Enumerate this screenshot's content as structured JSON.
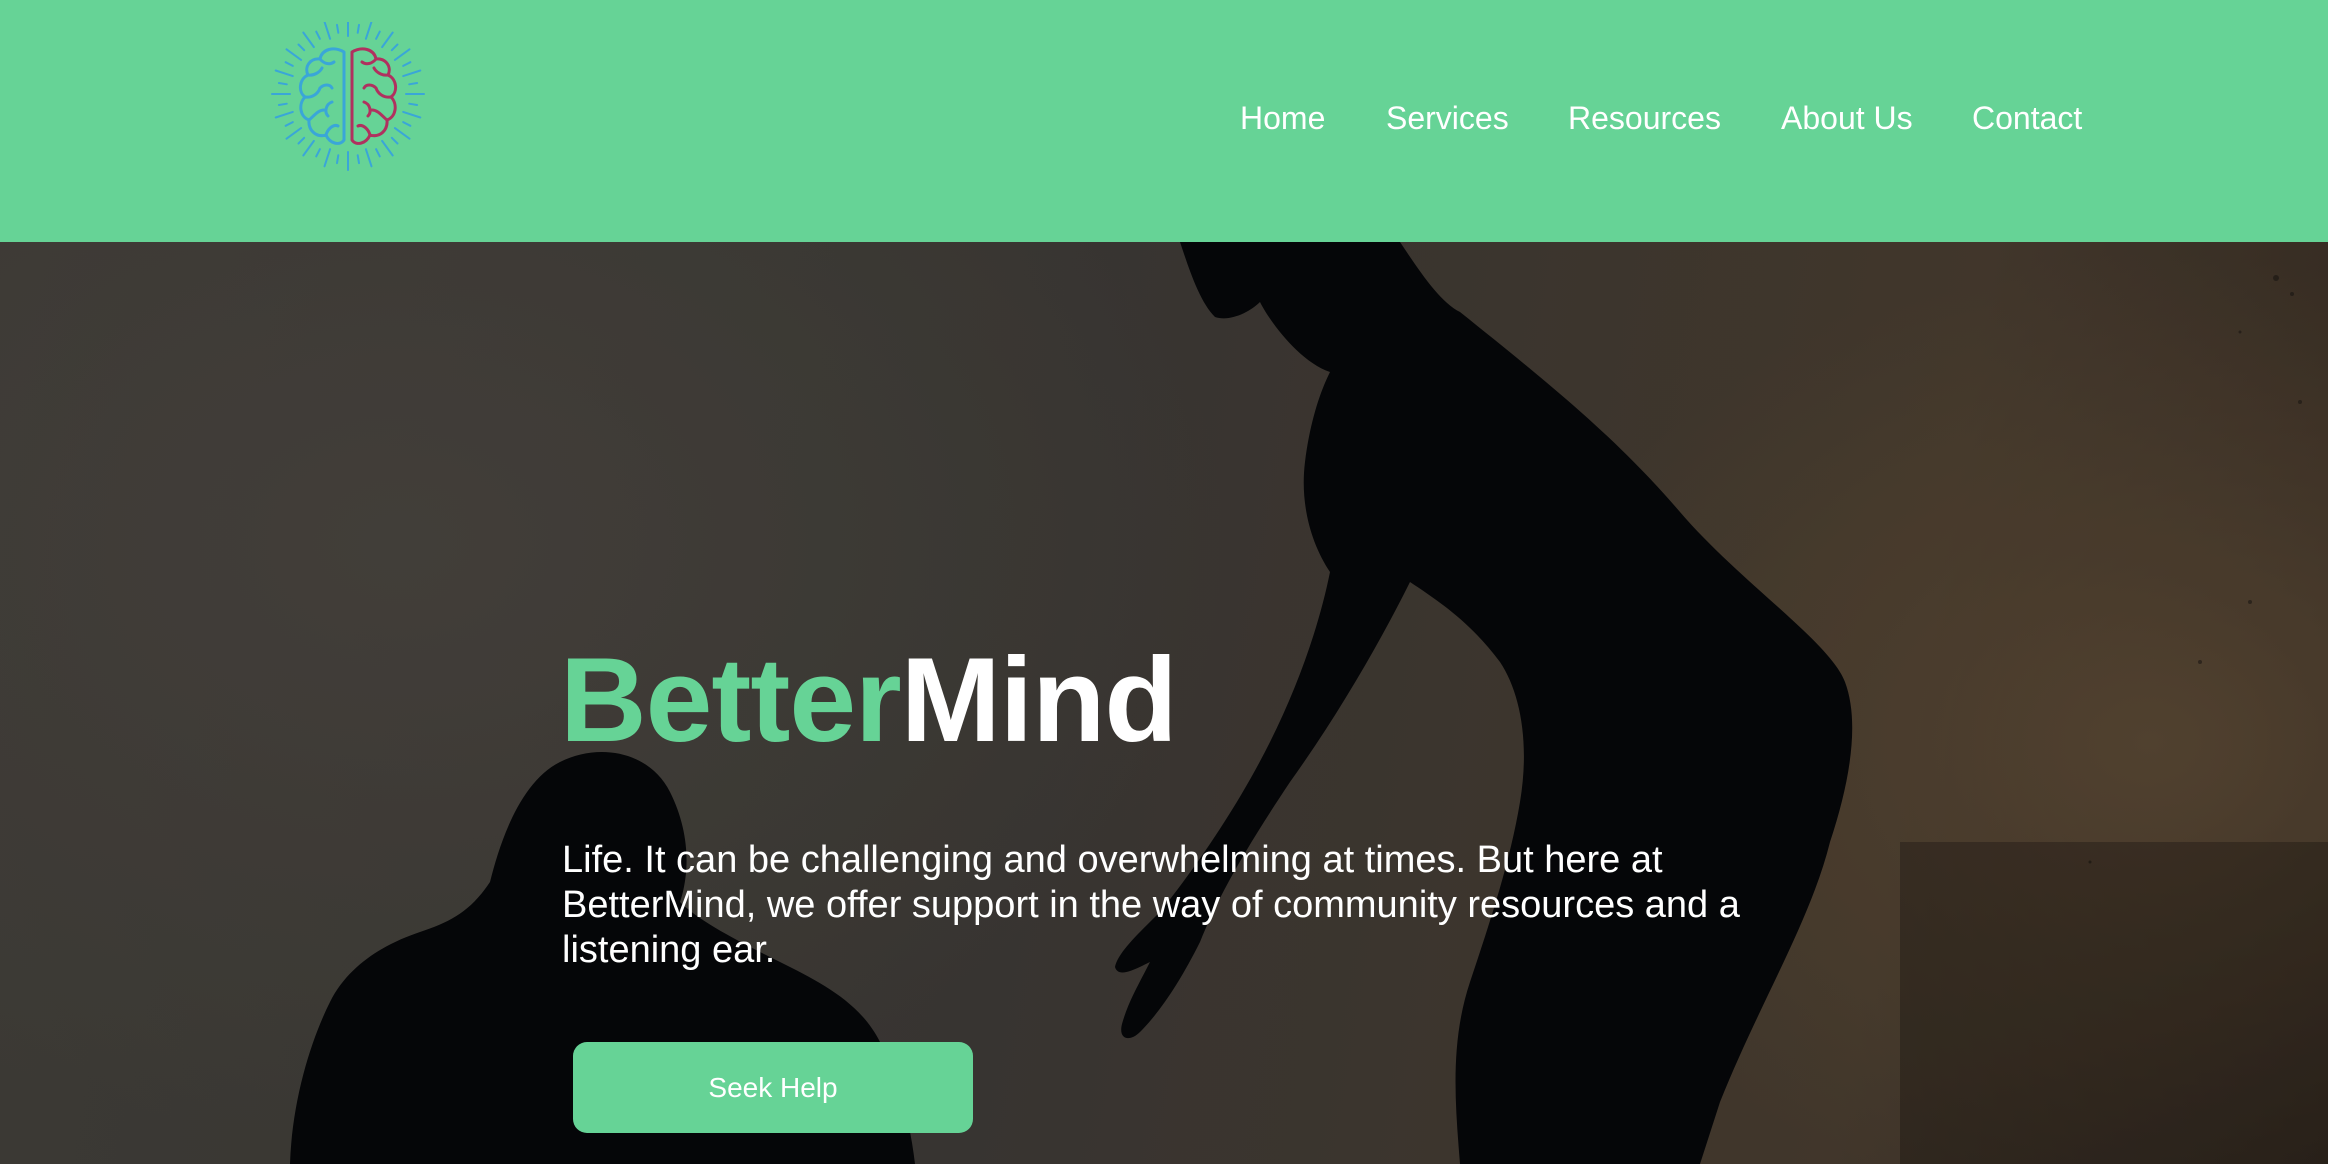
{
  "header": {
    "logo_icon": "brain-icon",
    "nav": {
      "home": "Home",
      "services": "Services",
      "resources": "Resources",
      "about": "About Us",
      "contact": "Contact"
    }
  },
  "hero": {
    "title_part1": "Better",
    "title_part2": "Mind",
    "description": "Life. It can be challenging and overwhelming at times. But here at BetterMind, we offer support in the way of community resources and a listening ear.",
    "cta_label": "Seek Help"
  },
  "colors": {
    "brand_green": "#66d396",
    "brain_left": "#3aa6d8",
    "brain_right": "#b0315f",
    "text_light": "#ffffff"
  }
}
